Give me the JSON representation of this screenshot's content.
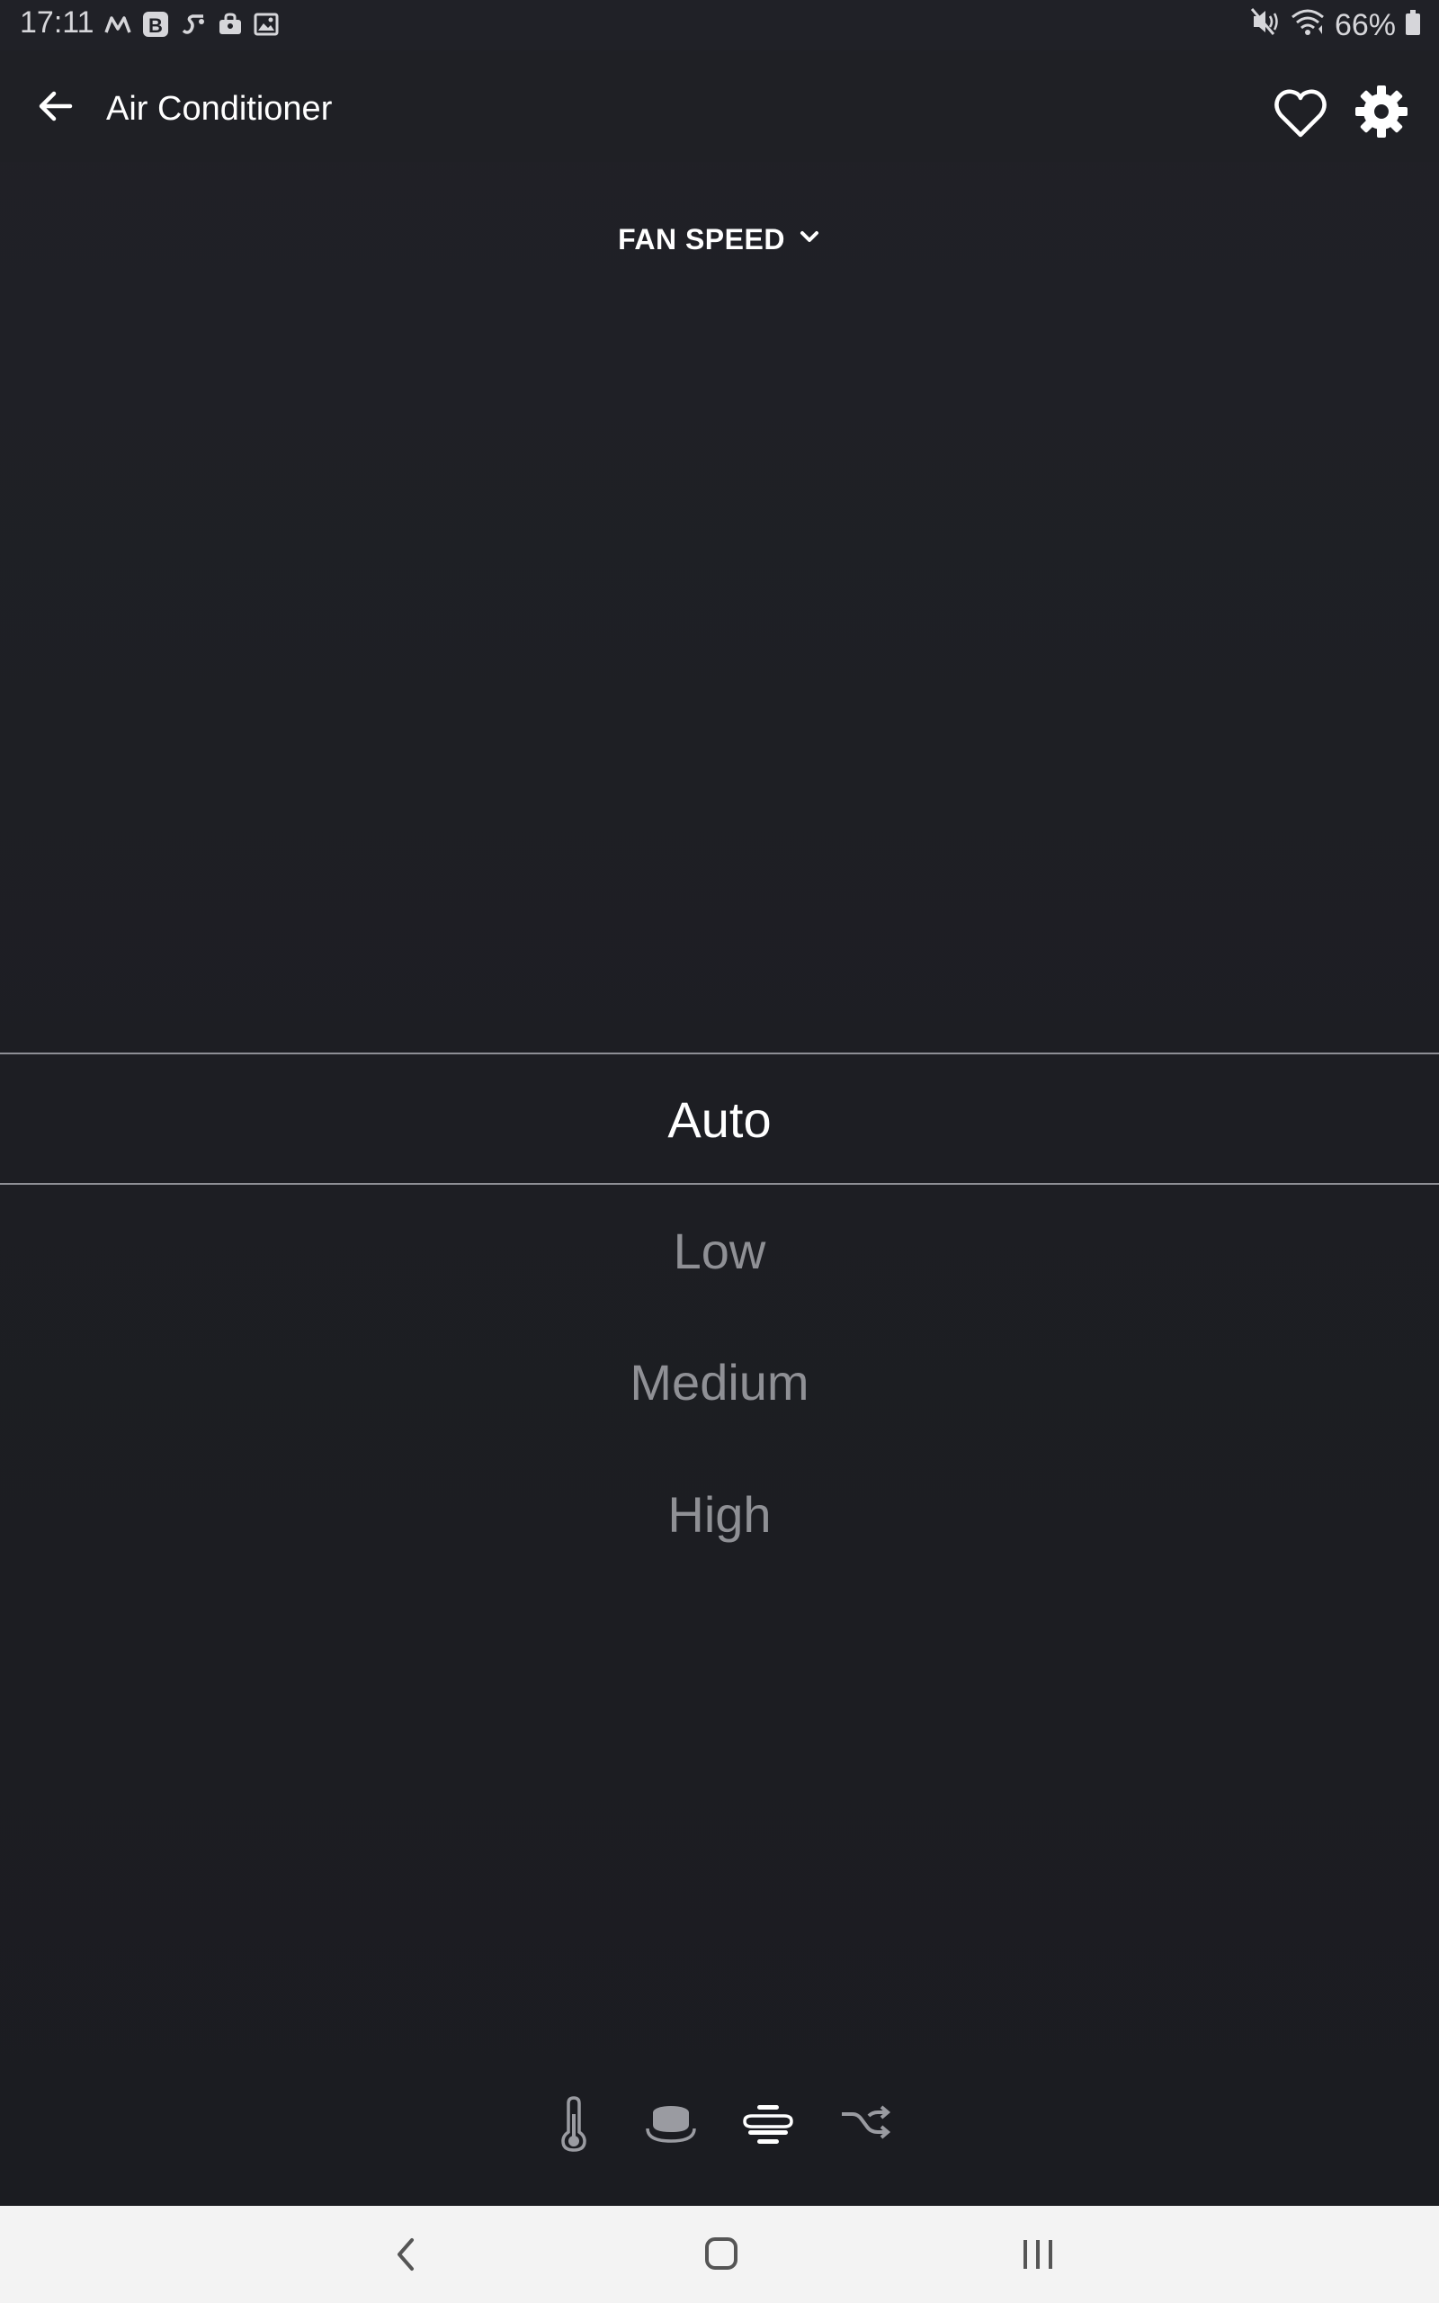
{
  "status_bar": {
    "time": "17:11",
    "battery": "66%",
    "left_icons": [
      "m-icon",
      "b-icon",
      "sonos-icon",
      "bag-icon",
      "image-icon"
    ],
    "right_icons": [
      "mute-vibrate-icon",
      "wifi-icon",
      "battery-icon"
    ]
  },
  "app_bar": {
    "title": "Air Conditioner",
    "back_icon": "arrow-left-icon",
    "favorite_icon": "heart-outline-icon",
    "settings_icon": "gear-icon"
  },
  "mode_selector": {
    "label": "FAN SPEED",
    "icon": "chevron-down-icon"
  },
  "picker": {
    "selected": "Auto",
    "options": [
      "Auto",
      "Low",
      "Medium",
      "High"
    ]
  },
  "bottom_tabs": [
    {
      "icon": "thermometer-icon"
    },
    {
      "icon": "puck-icon"
    },
    {
      "icon": "fan-speed-icon",
      "active": true
    },
    {
      "icon": "shuffle-icon"
    }
  ],
  "nav_bar": {
    "icons": [
      "nav-back-icon",
      "nav-home-icon",
      "nav-recents-icon"
    ]
  },
  "colors": {
    "background": "#1f2026",
    "text_primary": "#ffffff",
    "text_secondary": "#8f9095",
    "divider": "#8e8f95",
    "nav_bar": "#f3f3f3"
  }
}
